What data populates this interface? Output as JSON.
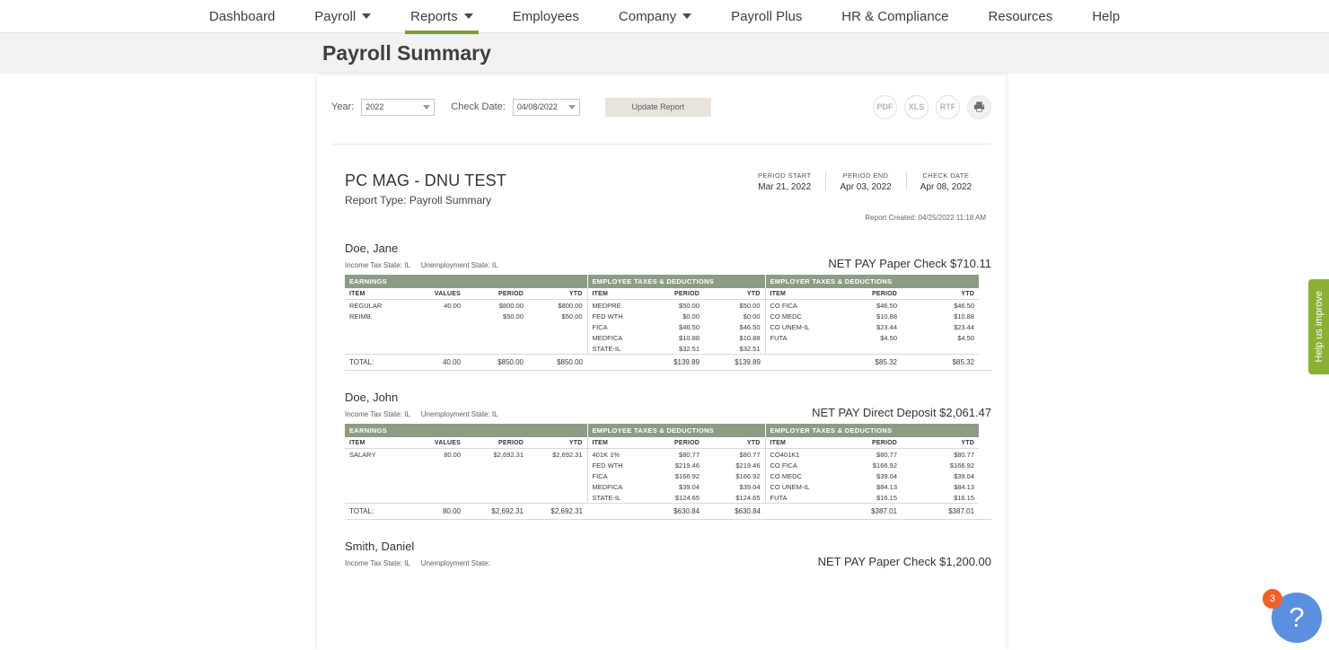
{
  "nav": {
    "items": [
      {
        "label": "Dashboard",
        "caret": false,
        "active": false
      },
      {
        "label": "Payroll",
        "caret": true,
        "active": false
      },
      {
        "label": "Reports",
        "caret": true,
        "active": true
      },
      {
        "label": "Employees",
        "caret": false,
        "active": false
      },
      {
        "label": "Company",
        "caret": true,
        "active": false
      },
      {
        "label": "Payroll Plus",
        "caret": false,
        "active": false
      },
      {
        "label": "HR & Compliance",
        "caret": false,
        "active": false
      },
      {
        "label": "Resources",
        "caret": false,
        "active": false
      },
      {
        "label": "Help",
        "caret": false,
        "active": false
      }
    ]
  },
  "page": {
    "title": "Payroll Summary"
  },
  "toolbar": {
    "year_label": "Year:",
    "year_value": "2022",
    "check_date_label": "Check Date:",
    "check_date_value": "04/08/2022",
    "update_label": "Update Report",
    "exports": [
      "PDF",
      "XLS",
      "RTF"
    ],
    "print_icon": "printer-icon"
  },
  "report": {
    "company": "PC MAG - DNU TEST",
    "report_type": "Report Type: Payroll Summary",
    "periods": [
      {
        "label": "PERIOD START",
        "value": "Mar 21, 2022"
      },
      {
        "label": "PERIOD END",
        "value": "Apr 03, 2022"
      },
      {
        "label": "CHECK DATE",
        "value": "Apr 08, 2022"
      }
    ],
    "created": "Report Created: 04/25/2022 11:18 AM",
    "group_headers": [
      "EARNINGS",
      "EMPLOYEE TAXES & DEDUCTIONS",
      "EMPLOYER TAXES & DEDUCTIONS"
    ],
    "earnings_columns": [
      "ITEM",
      "VALUES",
      "PERIOD",
      "YTD"
    ],
    "tax_columns": [
      "ITEM",
      "PERIOD",
      "YTD"
    ],
    "total_label": "TOTAL:",
    "employees": [
      {
        "name": "Doe, Jane",
        "income_tax_state": "Income Tax State: IL",
        "unemployment_state": "Unemployment State: IL",
        "net_pay": "NET PAY Paper Check $710.11",
        "earnings": [
          {
            "item": "REGULAR",
            "values": "40.00",
            "period": "$800.00",
            "ytd": "$800.00"
          },
          {
            "item": "REIMB.",
            "values": "",
            "period": "$50.00",
            "ytd": "$50.00"
          }
        ],
        "employee_taxes": [
          {
            "item": "MEDPRE",
            "period": "$50.00",
            "ytd": "$50.00"
          },
          {
            "item": "FED WTH",
            "period": "$0.00",
            "ytd": "$0.00"
          },
          {
            "item": "FICA",
            "period": "$46.50",
            "ytd": "$46.50"
          },
          {
            "item": "MEDFICA",
            "period": "$10.88",
            "ytd": "$10.88"
          },
          {
            "item": "STATE-IL",
            "period": "$32.51",
            "ytd": "$32.51"
          }
        ],
        "employer_taxes": [
          {
            "item": "CO FICA",
            "period": "$46.50",
            "ytd": "$46.50"
          },
          {
            "item": "CO MEDC",
            "period": "$10.88",
            "ytd": "$10.88"
          },
          {
            "item": "CO UNEM-IL",
            "period": "$23.44",
            "ytd": "$23.44"
          },
          {
            "item": "FUTA",
            "period": "$4.50",
            "ytd": "$4.50"
          }
        ],
        "totals": {
          "values": "40.00",
          "period": "$850.00",
          "ytd": "$850.00",
          "ee_period": "$139.89",
          "ee_ytd": "$139.89",
          "er_period": "$85.32",
          "er_ytd": "$85.32"
        }
      },
      {
        "name": "Doe, John",
        "income_tax_state": "Income Tax State: IL",
        "unemployment_state": "Unemployment State: IL",
        "net_pay": "NET PAY Direct Deposit $2,061.47",
        "earnings": [
          {
            "item": "SALARY",
            "values": "80.00",
            "period": "$2,692.31",
            "ytd": "$2,692.31"
          }
        ],
        "employee_taxes": [
          {
            "item": "401K 1%",
            "period": "$80.77",
            "ytd": "$80.77"
          },
          {
            "item": "FED WTH",
            "period": "$219.46",
            "ytd": "$219.46"
          },
          {
            "item": "FICA",
            "period": "$166.92",
            "ytd": "$166.92"
          },
          {
            "item": "MEDFICA",
            "period": "$39.04",
            "ytd": "$39.04"
          },
          {
            "item": "STATE-IL",
            "period": "$124.65",
            "ytd": "$124.65"
          }
        ],
        "employer_taxes": [
          {
            "item": "CO401K1",
            "period": "$80.77",
            "ytd": "$80.77"
          },
          {
            "item": "CO FICA",
            "period": "$166.92",
            "ytd": "$166.92"
          },
          {
            "item": "CO MEDC",
            "period": "$39.04",
            "ytd": "$39.04"
          },
          {
            "item": "CO UNEM-IL",
            "period": "$84.13",
            "ytd": "$84.13"
          },
          {
            "item": "FUTA",
            "period": "$16.15",
            "ytd": "$16.15"
          }
        ],
        "totals": {
          "values": "80.00",
          "period": "$2,692.31",
          "ytd": "$2,692.31",
          "ee_period": "$630.84",
          "ee_ytd": "$630.84",
          "er_period": "$387.01",
          "er_ytd": "$387.01"
        }
      },
      {
        "name": "Smith, Daniel",
        "income_tax_state": "Income Tax State: IL",
        "unemployment_state": "Unemployment State:",
        "net_pay": "NET PAY Paper Check $1,200.00",
        "earnings": [],
        "employee_taxes": [],
        "employer_taxes": [],
        "totals": null
      }
    ]
  },
  "widgets": {
    "help_tab_label": "Help us improve",
    "chat_icon": "question-mark-icon",
    "chat_badge": "3"
  },
  "colors": {
    "accent_green": "#7d9c2e",
    "table_header": "#8d9c85",
    "help_tab": "#8cb033",
    "chat_button": "#5b8fe0",
    "chat_badge": "#f2602a"
  }
}
